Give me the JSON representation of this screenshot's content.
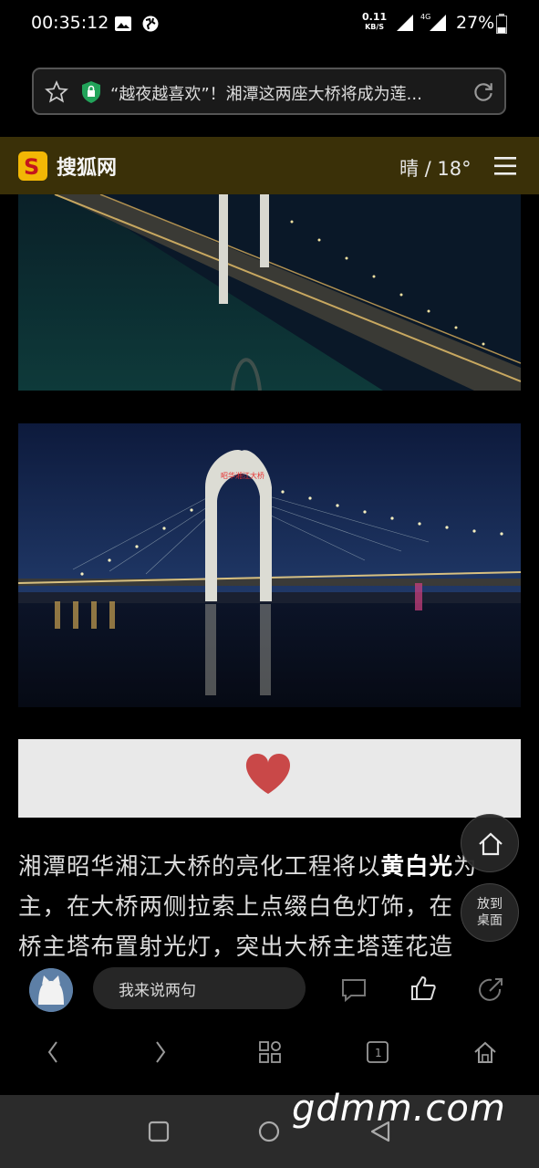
{
  "status_bar": {
    "time": "00:35:12",
    "net_speed": "0.11",
    "net_unit": "KB/S",
    "network_type": "4G",
    "battery": "27%"
  },
  "url_bar": {
    "title": "“越夜越喜欢”！湘潭这两座大桥将成为莲..."
  },
  "site": {
    "name": "搜狐网",
    "weather": "晴 / 18°",
    "accent": "#f2b705"
  },
  "image2": {
    "sign_text": "昭华湘江大桥"
  },
  "article": {
    "line1_a": "湘潭昭华湘江大桥的亮化工程将以",
    "line1_b": "黄白光",
    "line1_c": "为",
    "line2": "主，在大桥两侧拉索上点缀白色灯饰，",
    "line2_tail": "在",
    "line3": "桥主塔布置射光灯，突出大桥主塔莲花造"
  },
  "fab": {
    "desktop_label_1": "放到",
    "desktop_label_2": "桌面"
  },
  "comment_bar": {
    "placeholder": "我来说两句"
  },
  "watermark": "gdmm.com"
}
